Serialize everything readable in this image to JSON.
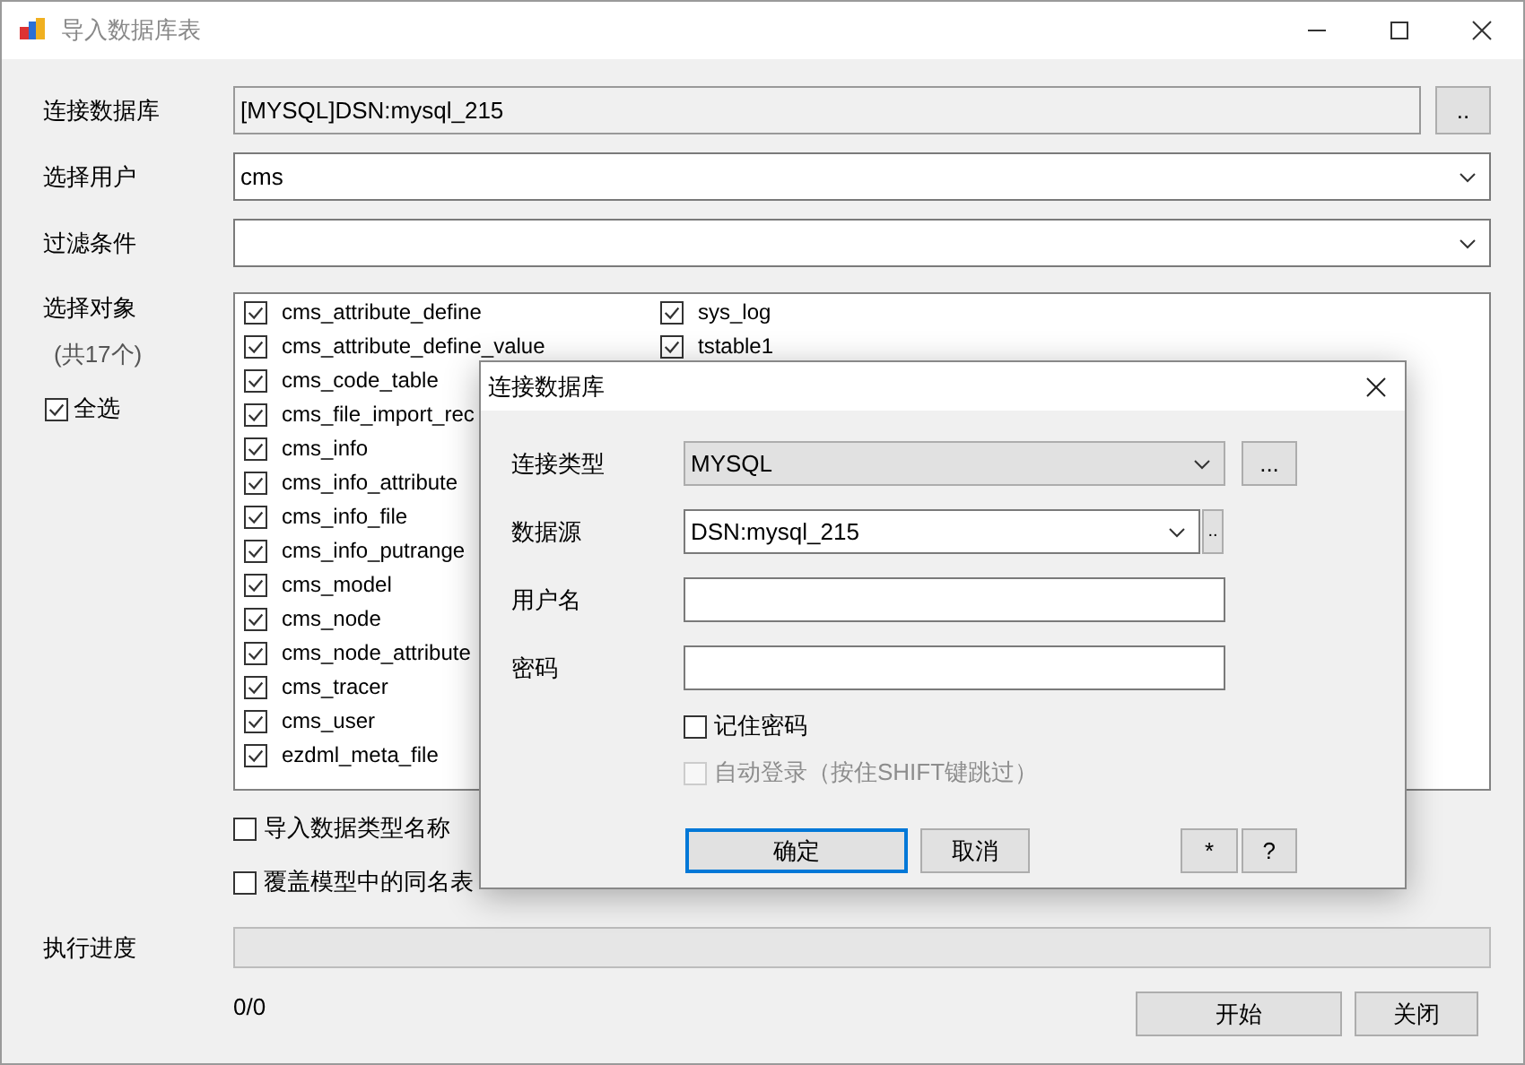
{
  "window": {
    "title": "导入数据库表"
  },
  "connection": {
    "label": "连接数据库",
    "value": "[MYSQL]DSN:mysql_215",
    "button": ".."
  },
  "user": {
    "label": "选择用户",
    "value": "cms"
  },
  "filter": {
    "label": "过滤条件"
  },
  "objects": {
    "label": "选择对象",
    "count": "(共17个)",
    "select_all": {
      "label": "全选",
      "checked": true
    },
    "items": [
      {
        "name": "cms_attribute_define",
        "checked": true
      },
      {
        "name": "cms_attribute_define_value",
        "checked": true
      },
      {
        "name": "cms_code_table",
        "checked": true
      },
      {
        "name": "cms_file_import_rec",
        "checked": true
      },
      {
        "name": "cms_info",
        "checked": true
      },
      {
        "name": "cms_info_attribute",
        "checked": true
      },
      {
        "name": "cms_info_file",
        "checked": true
      },
      {
        "name": "cms_info_putrange",
        "checked": true
      },
      {
        "name": "cms_model",
        "checked": true
      },
      {
        "name": "cms_node",
        "checked": true
      },
      {
        "name": "cms_node_attribute",
        "checked": true
      },
      {
        "name": "cms_tracer",
        "checked": true
      },
      {
        "name": "cms_user",
        "checked": true
      },
      {
        "name": "ezdml_meta_file",
        "checked": true
      },
      {
        "name": "sys_log",
        "checked": true
      },
      {
        "name": "tstable1",
        "checked": true
      }
    ]
  },
  "options": [
    {
      "label": "导入数据类型名称",
      "checked": false
    },
    {
      "label": "覆盖模型中的同名表",
      "checked": false
    }
  ],
  "progress": {
    "label": "执行进度",
    "level": 0,
    "reading": "0/0"
  },
  "buttons": [
    {
      "label": "开始"
    },
    {
      "label": "关闭"
    }
  ],
  "dialog": {
    "title": "连接数据库",
    "fields": [
      {
        "kind": "dropdown",
        "label": "连接类型",
        "value": "MYSQL",
        "button": "..."
      },
      {
        "kind": "combo",
        "label": "数据源",
        "value": "DSN:mysql_215",
        "button": ".."
      },
      {
        "kind": "text",
        "label": "用户名"
      },
      {
        "kind": "text",
        "label": "密码"
      }
    ],
    "checks": [
      {
        "label": "记住密码",
        "checked": false,
        "disabled": false
      },
      {
        "label": "自动登录（按住SHIFT键跳过）",
        "checked": false,
        "disabled": true
      }
    ],
    "buttons": [
      {
        "label": "确定",
        "default": true
      },
      {
        "label": "取消",
        "default": false
      }
    ],
    "small_buttons": [
      {
        "label": "*"
      },
      {
        "label": "?"
      }
    ]
  }
}
